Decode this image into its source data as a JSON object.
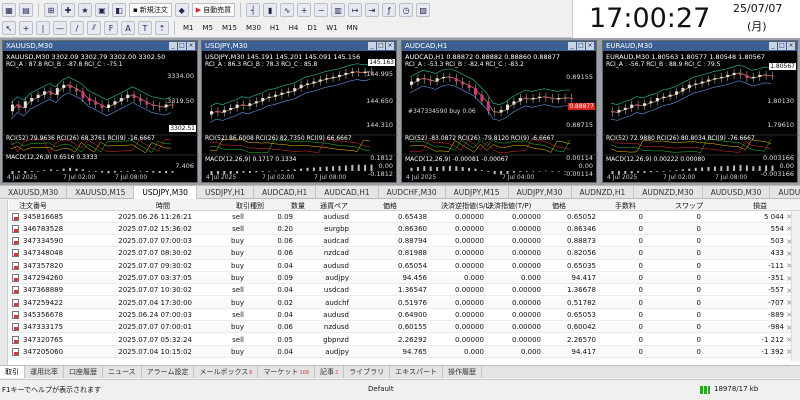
{
  "toolbar": {
    "new_order_label": "新規注文",
    "auto_trade_label": "自動売買",
    "timeframes": [
      "M1",
      "M5",
      "M15",
      "M30",
      "H1",
      "H4",
      "D1",
      "W1",
      "MN"
    ]
  },
  "clock": {
    "time": "17:00:27",
    "date": "25/07/07",
    "weekday": "(月)"
  },
  "charts": [
    {
      "title": "XAUUSD,M30",
      "symbol_line": "XAUUSD,M30  3302.09 3302.79 3302.00 3302.50",
      "rci_line": "RCI_A : 87.8  RCI_B : -87.8  RCI_C : -75.1",
      "rci2_line": "RCI(52) 79.9636  RCI(26) 68.3761  RCI(9) -16.6667",
      "macd_line": "MACD(12,26,9) 0.6516 0.3333",
      "prices": [
        "3334.00",
        "3319.50",
        "3307.51"
      ],
      "sub_prices": [
        "7.406"
      ],
      "x_labels": [
        "4 Jul 2025",
        "7 Jul 02:00",
        "7 Jul 08:00"
      ],
      "tag": "3302.51"
    },
    {
      "title": "USDJPY,M30",
      "symbol_line": "USDJPY,M30  145.191 145.201 145.091 145.156",
      "rci_line": "RCI_A : 86.3  RCI_B : 78.3  RCI_C : 85.8",
      "rci2_line": "RCI(52) 86.6008  RCI(26) 82.7350  RCI(9) 66.6667",
      "macd_line": "MACD(12,26,9) 0.1717 0.1334",
      "prices": [
        "144.995",
        "144.650",
        "144.310"
      ],
      "sub_prices": [
        "0.1812",
        "0.00",
        "-0.1812"
      ],
      "x_labels": [
        "4 Jul 2025",
        "7 Jul 02:00",
        "7 Jul 08:00"
      ],
      "tag": "145.163"
    },
    {
      "title": "AUDCAD,H1",
      "symbol_line": "AUDCAD,H1  0.88872 0.88882 0.88860 0.88877",
      "rci_line": "RCI_A : -53.3  RCI_B : -82.4  RCI_C : -83.2",
      "rci2_line": "RCI(52) -83.0872  RCI(26) -79.8120  RCI(9) -6.6667",
      "macd_line": "MACD(12,26,9) -0.00081 -0.00067",
      "prices": [
        "0.89155",
        "0.88877",
        "0.88715"
      ],
      "sub_prices": [
        "0.00114",
        "0.00",
        "-0.00114"
      ],
      "x_labels": [
        "4 Jul 2025",
        "7 Jul 04:00"
      ],
      "tag": "0.88877",
      "order_label": "#347334590 buy 0.06"
    },
    {
      "title": "EURAUD,M30",
      "symbol_line": "EURAUD,M30  1.80563 1.80577 1.80548 1.80567",
      "rci_line": "RCI_A : -56.7  RCI_B : 88.9  RCI_C : 79.5",
      "rci2_line": "RCI(52) 72.9880  RCI(26) 80.8034  RCI(9) -76.6667",
      "macd_line": "MACD(12,26,9) 0.00222 0.00080",
      "prices": [
        "1.80567",
        "1.80130",
        "1.79610"
      ],
      "sub_prices": [
        "0.003166",
        "0.00",
        "-0.003166"
      ],
      "x_labels": [
        "4 Jul 2025",
        "7 Jul 02:00",
        "7 Jul 08:00"
      ],
      "tag": "1.80567"
    }
  ],
  "chart_tabs": [
    "XAUUSD,M30",
    "XAUUSD,M15",
    "USDJPY,M30",
    "USDJPY,H1",
    "AUDCAD,H1",
    "AUDCAD,H1",
    "AUDCHF,M30",
    "AUDJPY,M15",
    "AUDJPY,M30",
    "AUDNZD,H1",
    "AUDNZD,M30",
    "AUDUSD,M30",
    "AUDUSD,H"
  ],
  "chart_tabs_active": 2,
  "terminal": {
    "headers": [
      "注文番号",
      "時間",
      "取引種別",
      "数量",
      "通貨ペア",
      "価格",
      "決済逆指値(S/L)",
      "決済指値(T/P)",
      "価格",
      "手数料",
      "スワップ",
      "損益"
    ],
    "rows": [
      [
        "345816685",
        "2025.06.26 11:26:21",
        "sell",
        "0.09",
        "audusd",
        "0.65438",
        "0.00000",
        "0.00000",
        "0.65052",
        "0",
        "0",
        "5 044"
      ],
      [
        "346783528",
        "2025.07.02 15:36:02",
        "sell",
        "0.20",
        "eurgbp",
        "0.86360",
        "0.00000",
        "0.00000",
        "0.86346",
        "0",
        "0",
        "554"
      ],
      [
        "347334590",
        "2025.07.07 07:00:03",
        "buy",
        "0.06",
        "audcad",
        "0.88794",
        "0.00000",
        "0.00000",
        "0.88873",
        "0",
        "0",
        "503"
      ],
      [
        "347348048",
        "2025.07.07 08:30:02",
        "buy",
        "0.06",
        "nzdcad",
        "0.81988",
        "0.00000",
        "0.00000",
        "0.82056",
        "0",
        "0",
        "433"
      ],
      [
        "347357820",
        "2025.07.07 09:30:02",
        "buy",
        "0.04",
        "audusd",
        "0.65054",
        "0.00000",
        "0.00000",
        "0.65035",
        "0",
        "0",
        "-111"
      ],
      [
        "347294260",
        "2025.07.07 03:37:05",
        "buy",
        "0.09",
        "audjpy",
        "94.456",
        "0.000",
        "0.000",
        "94.417",
        "0",
        "0",
        "-351"
      ],
      [
        "347368889",
        "2025.07.07 10:30:02",
        "sell",
        "0.04",
        "usdcad",
        "1.36547",
        "0.00000",
        "0.00000",
        "1.36678",
        "0",
        "0",
        "-557"
      ],
      [
        "347259422",
        "2025.07.04 17:30:00",
        "buy",
        "0.02",
        "audchf",
        "0.51976",
        "0.00000",
        "0.00000",
        "0.51782",
        "0",
        "0",
        "-707"
      ],
      [
        "345356678",
        "2025.06.24 07:00:03",
        "sell",
        "0.04",
        "audusd",
        "0.64900",
        "0.00000",
        "0.00000",
        "0.65053",
        "0",
        "0",
        "-889"
      ],
      [
        "347333175",
        "2025.07.07 07:00:01",
        "buy",
        "0.06",
        "nzdusd",
        "0.60155",
        "0.00000",
        "0.00000",
        "0.60042",
        "0",
        "0",
        "-984"
      ],
      [
        "347320765",
        "2025.07.07 05:32:24",
        "sell",
        "0.05",
        "gbpnzd",
        "2.26292",
        "0.00000",
        "0.00000",
        "2.26570",
        "0",
        "0",
        "-1 212"
      ],
      [
        "347205060",
        "2025.07.04 10:15:02",
        "buy",
        "0.04",
        "audjpy",
        "94.765",
        "0.000",
        "0.000",
        "94.417",
        "0",
        "0",
        "-1 392"
      ]
    ]
  },
  "bottom_tabs": [
    {
      "label": "取引",
      "badge": ""
    },
    {
      "label": "運用比率",
      "badge": ""
    },
    {
      "label": "口座履歴",
      "badge": ""
    },
    {
      "label": "ニュース",
      "badge": ""
    },
    {
      "label": "アラーム設定",
      "badge": ""
    },
    {
      "label": "メールボックス",
      "badge": "6"
    },
    {
      "label": "マーケット",
      "badge": "109"
    },
    {
      "label": "記事",
      "badge": "2"
    },
    {
      "label": "ライブラリ",
      "badge": ""
    },
    {
      "label": "エキスパート",
      "badge": ""
    },
    {
      "label": "操作履歴",
      "badge": ""
    }
  ],
  "status": {
    "help": "F1キーでヘルプが表示されます",
    "profile": "Default",
    "connection": "18978/17 kb"
  }
}
